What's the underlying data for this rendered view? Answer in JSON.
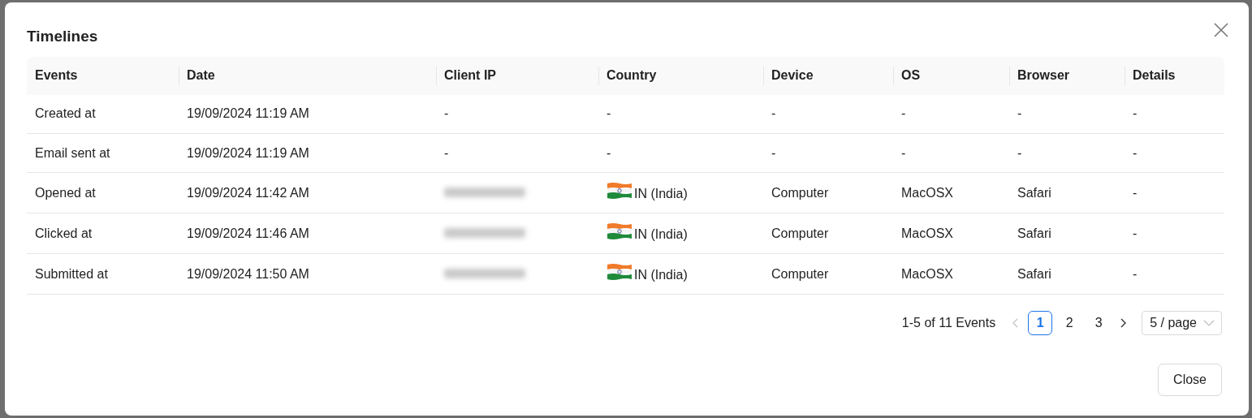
{
  "dialog": {
    "title": "Timelines"
  },
  "table": {
    "columns": [
      "Events",
      "Date",
      "Client IP",
      "Country",
      "Device",
      "OS",
      "Browser",
      "Details"
    ],
    "rows": [
      {
        "event": "Created at",
        "date": "19/09/2024 11:19 AM",
        "client_ip": "-",
        "client_ip_blurred": false,
        "country": "-",
        "show_flag": false,
        "device": "-",
        "os": "-",
        "browser": "-",
        "details": "-"
      },
      {
        "event": "Email sent at",
        "date": "19/09/2024 11:19 AM",
        "client_ip": "-",
        "client_ip_blurred": false,
        "country": "-",
        "show_flag": false,
        "device": "-",
        "os": "-",
        "browser": "-",
        "details": "-"
      },
      {
        "event": "Opened at",
        "date": "19/09/2024 11:42 AM",
        "client_ip_blurred": true,
        "country": "IN (India)",
        "show_flag": true,
        "device": "Computer",
        "os": "MacOSX",
        "browser": "Safari",
        "details": "-"
      },
      {
        "event": "Clicked at",
        "date": "19/09/2024 11:46 AM",
        "client_ip_blurred": true,
        "country": "IN (India)",
        "show_flag": true,
        "device": "Computer",
        "os": "MacOSX",
        "browser": "Safari",
        "details": "-"
      },
      {
        "event": "Submitted at",
        "date": "19/09/2024 11:50 AM",
        "client_ip_blurred": true,
        "country": "IN (India)",
        "show_flag": true,
        "device": "Computer",
        "os": "MacOSX",
        "browser": "Safari",
        "details": "-"
      }
    ]
  },
  "pagination": {
    "summary": "1-5 of 11 Events",
    "prev_disabled": true,
    "pages": [
      {
        "label": "1",
        "selected": true
      },
      {
        "label": "2",
        "selected": false
      },
      {
        "label": "3",
        "selected": false
      }
    ],
    "page_size": "5 / page"
  },
  "footer": {
    "close_button": "Close"
  }
}
